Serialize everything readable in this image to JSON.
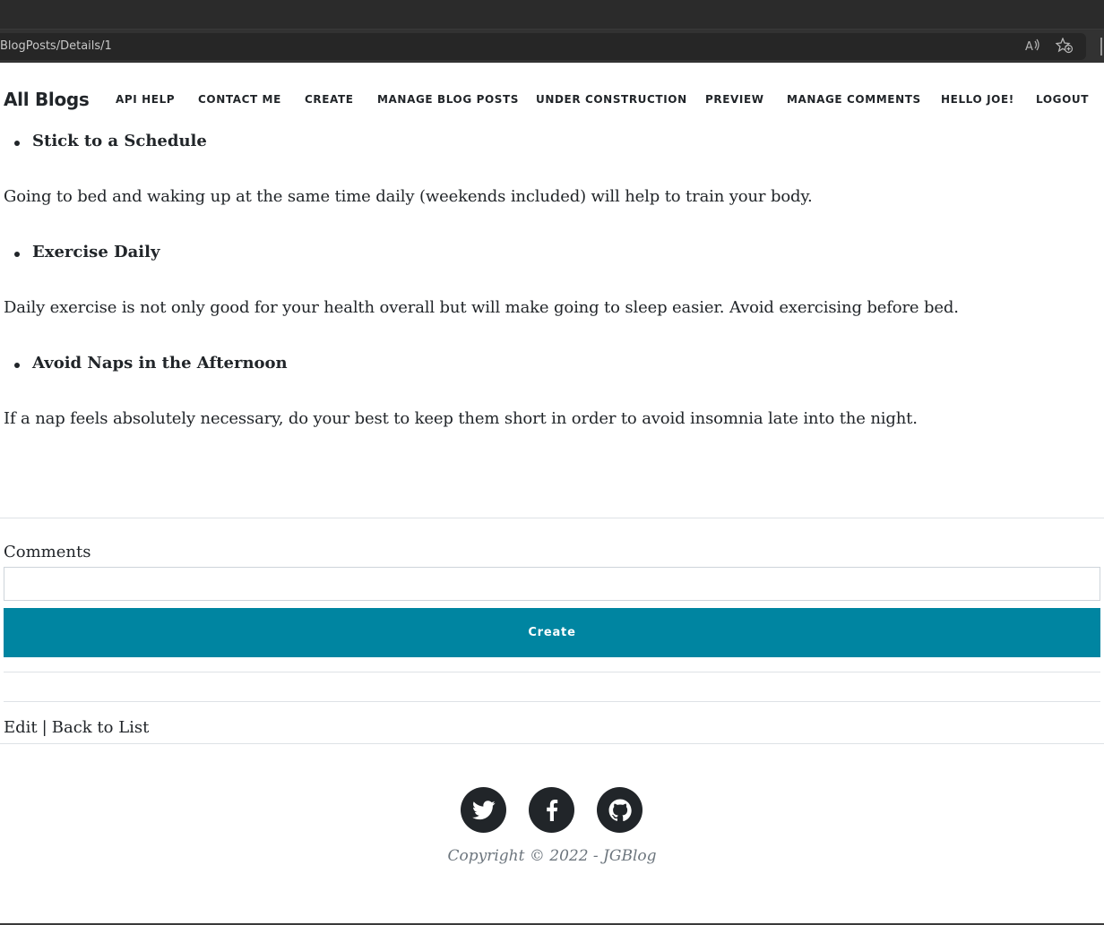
{
  "browser": {
    "url": "BlogPosts/Details/1",
    "read_aloud_icon": "read-aloud-icon",
    "favorites_icon": "add-favorite-icon"
  },
  "navbar": {
    "brand": "All Blogs",
    "items": [
      {
        "label": "API Help"
      },
      {
        "label": "Contact Me"
      },
      {
        "label": "Create"
      },
      {
        "label": "Manage Blog Posts"
      },
      {
        "label": "Under Construction"
      },
      {
        "label": "Preview"
      },
      {
        "label": "Manage Comments"
      },
      {
        "label": "Hello Joe!"
      },
      {
        "label": "Logout"
      }
    ]
  },
  "article": {
    "sections": [
      {
        "heading": "Stick to a Schedule",
        "text": "Going to bed and waking up at the same time daily (weekends included) will help to train your body."
      },
      {
        "heading": "Exercise Daily",
        "text": "Daily exercise is not only good for your health overall but will make going to sleep easier. Avoid exercising before bed."
      },
      {
        "heading": "Avoid Naps in the Afternoon",
        "text": "If a nap feels absolutely necessary, do your best to keep them short in order to avoid insomnia late into the night."
      }
    ]
  },
  "comments": {
    "label": "Comments",
    "input_value": "",
    "create_label": "Create"
  },
  "links": {
    "edit": "Edit",
    "separator": "|",
    "back": "Back to List"
  },
  "footer": {
    "social": [
      "twitter-icon",
      "facebook-icon",
      "github-icon"
    ],
    "copyright": "Copyright © 2022 - JGBlog"
  },
  "colors": {
    "accent": "#0085a1",
    "text": "#212529",
    "muted": "#6c757d",
    "chrome": "#2b2b2b"
  }
}
